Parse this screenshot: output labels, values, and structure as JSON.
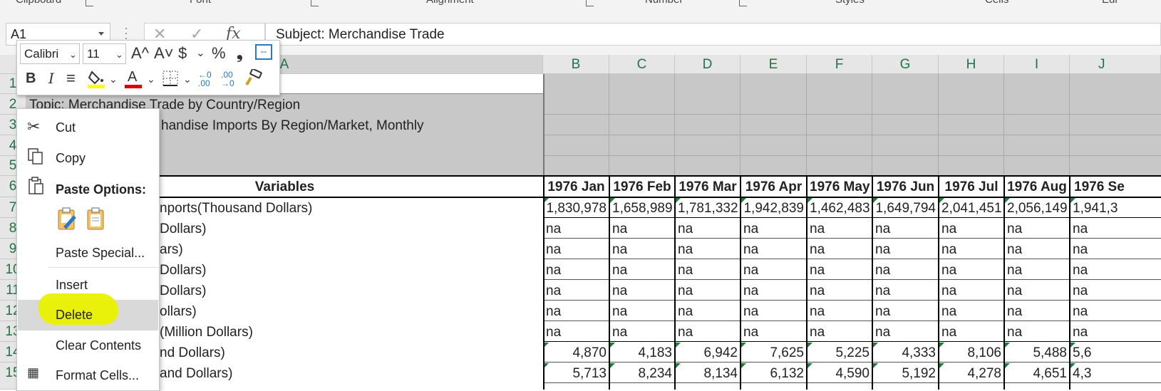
{
  "ribbon": {
    "groups": [
      "Clipboard",
      "Font",
      "Alignment",
      "Number",
      "Styles",
      "Cells",
      "Edi"
    ]
  },
  "formula_bar": {
    "name_box": "A1",
    "cancel_symbol": "✕",
    "enter_symbol": "✓",
    "fx_symbol": "fx",
    "content": "Subject: Merchandise Trade"
  },
  "columns": [
    "A",
    "B",
    "C",
    "D",
    "E",
    "F",
    "G",
    "H",
    "I",
    "J"
  ],
  "rows": {
    "numbers": [
      "1",
      "2",
      "3",
      "4",
      "5",
      "6",
      "7",
      "8",
      "9",
      "10",
      "11",
      "12",
      "13",
      "14",
      "15"
    ],
    "row2_text": "Topic: Merchandise Trade by Country/Region",
    "row3_text": "handise Imports By Region/Market, Monthly",
    "header_label": "Variables",
    "months": [
      "1976 Jan",
      "1976 Feb",
      "1976 Mar",
      "1976 Apr",
      "1976 May",
      "1976 Jun",
      "1976 Jul",
      "1976 Aug",
      "1976 Se"
    ],
    "labels": [
      "nports(Thousand Dollars)",
      "Dollars)",
      "ars)",
      "Dollars)",
      "Dollars)",
      "ollars)",
      "(Million Dollars)",
      "nd Dollars)",
      "and Dollars)"
    ],
    "values": [
      [
        "1,830,978",
        "1,658,989",
        "1,781,332",
        "1,942,839",
        "1,462,483",
        "1,649,794",
        "2,041,451",
        "2,056,149",
        "1,941,3"
      ],
      [
        "na",
        "na",
        "na",
        "na",
        "na",
        "na",
        "na",
        "na",
        "na"
      ],
      [
        "na",
        "na",
        "na",
        "na",
        "na",
        "na",
        "na",
        "na",
        "na"
      ],
      [
        "na",
        "na",
        "na",
        "na",
        "na",
        "na",
        "na",
        "na",
        "na"
      ],
      [
        "na",
        "na",
        "na",
        "na",
        "na",
        "na",
        "na",
        "na",
        "na"
      ],
      [
        "na",
        "na",
        "na",
        "na",
        "na",
        "na",
        "na",
        "na",
        "na"
      ],
      [
        "na",
        "na",
        "na",
        "na",
        "na",
        "na",
        "na",
        "na",
        "na"
      ],
      [
        "4,870",
        "4,183",
        "6,942",
        "7,625",
        "5,225",
        "4,333",
        "8,106",
        "5,488",
        "5,6"
      ],
      [
        "5,713",
        "8,234",
        "8,134",
        "6,132",
        "4,590",
        "5,192",
        "4,278",
        "4,651",
        "4,3"
      ]
    ]
  },
  "mini_toolbar": {
    "font": "Calibri",
    "size": "11",
    "grow": "A^",
    "shrink": "A˅",
    "currency": "$",
    "percent": "%",
    "comma": "❟",
    "bold": "B",
    "italic": "I",
    "font_color": "A"
  },
  "context_menu": {
    "cut": "Cut",
    "copy": "Copy",
    "paste_options": "Paste Options:",
    "paste_special": "Paste Special...",
    "insert": "Insert",
    "delete": "Delete",
    "clear_contents": "Clear Contents",
    "format_cells": "Format Cells..."
  },
  "colors": {
    "header_green": "#217346",
    "highlight_marker": "#eaf200"
  }
}
